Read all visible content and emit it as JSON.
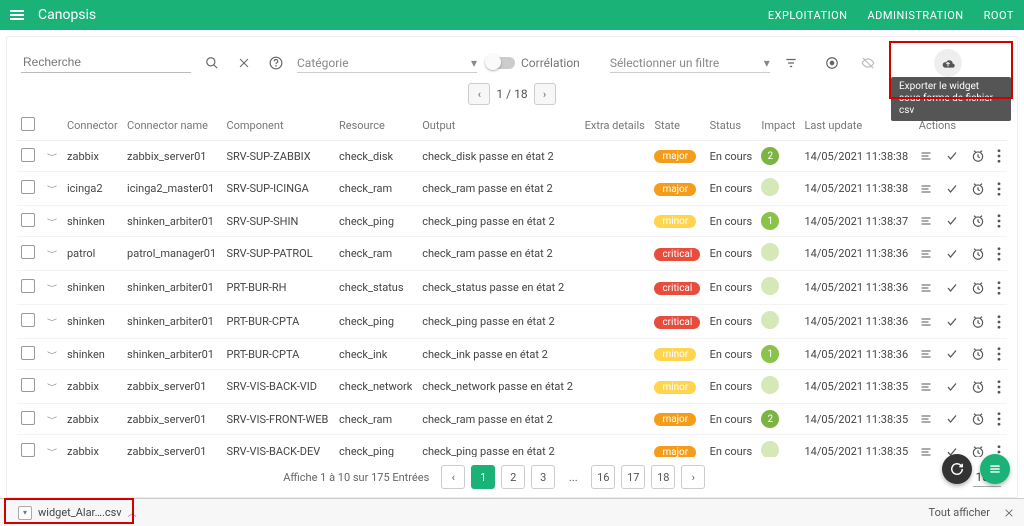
{
  "topbar": {
    "brand": "Canopsis",
    "links": {
      "exploitation": "EXPLOITATION",
      "administration": "ADMINISTRATION",
      "root": "ROOT"
    }
  },
  "filters": {
    "search_placeholder": "Recherche",
    "category_label": "Catégorie",
    "correlation_label": "Corrélation",
    "select_filter_label": "Sélectionner un filtre",
    "tooltip": "Exporter le widget sous forme de fichier csv",
    "top_pager": "1 / 18"
  },
  "columns": {
    "connector": "Connector",
    "connector_name": "Connector name",
    "component": "Component",
    "resource": "Resource",
    "output": "Output",
    "extra": "Extra details",
    "state": "State",
    "status": "Status",
    "impact": "Impact",
    "last_update": "Last update",
    "actions": "Actions"
  },
  "status_text": "En cours",
  "rows": [
    {
      "connector": "zabbix",
      "connector_name": "zabbix_server01",
      "component": "SRV-SUP-ZABBIX",
      "resource": "check_disk",
      "output": "check_disk passe en état 2",
      "state": "major",
      "impact": "2",
      "impcls": "imp2",
      "last_update": "14/05/2021 11:38:38"
    },
    {
      "connector": "icinga2",
      "connector_name": "icinga2_master01",
      "component": "SRV-SUP-ICINGA",
      "resource": "check_ram",
      "output": "check_ram passe en état 2",
      "state": "major",
      "impact": "",
      "impcls": "imp0",
      "last_update": "14/05/2021 11:38:38"
    },
    {
      "connector": "shinken",
      "connector_name": "shinken_arbiter01",
      "component": "SRV-SUP-SHIN",
      "resource": "check_ping",
      "output": "check_ping passe en état 2",
      "state": "minor",
      "impact": "1",
      "impcls": "imp1",
      "last_update": "14/05/2021 11:38:37"
    },
    {
      "connector": "patrol",
      "connector_name": "patrol_manager01",
      "component": "SRV-SUP-PATROL",
      "resource": "check_ram",
      "output": "check_ram passe en état 2",
      "state": "critical",
      "impact": "",
      "impcls": "imp0",
      "last_update": "14/05/2021 11:38:36"
    },
    {
      "connector": "shinken",
      "connector_name": "shinken_arbiter01",
      "component": "PRT-BUR-RH",
      "resource": "check_status",
      "output": "check_status passe en état 2",
      "state": "critical",
      "impact": "",
      "impcls": "imp0",
      "last_update": "14/05/2021 11:38:36"
    },
    {
      "connector": "shinken",
      "connector_name": "shinken_arbiter01",
      "component": "PRT-BUR-CPTA",
      "resource": "check_ping",
      "output": "check_ping passe en état 2",
      "state": "critical",
      "impact": "",
      "impcls": "imp0",
      "last_update": "14/05/2021 11:38:36"
    },
    {
      "connector": "shinken",
      "connector_name": "shinken_arbiter01",
      "component": "PRT-BUR-CPTA",
      "resource": "check_ink",
      "output": "check_ink passe en état 2",
      "state": "minor",
      "impact": "1",
      "impcls": "imp1",
      "last_update": "14/05/2021 11:38:36"
    },
    {
      "connector": "zabbix",
      "connector_name": "zabbix_server01",
      "component": "SRV-VIS-BACK-VID",
      "resource": "check_network",
      "output": "check_network passe en état 2",
      "state": "minor",
      "impact": "",
      "impcls": "imp0",
      "last_update": "14/05/2021 11:38:35"
    },
    {
      "connector": "zabbix",
      "connector_name": "zabbix_server01",
      "component": "SRV-VIS-FRONT-WEB",
      "resource": "check_ram",
      "output": "check_ram passe en état 2",
      "state": "major",
      "impact": "2",
      "impcls": "imp2",
      "last_update": "14/05/2021 11:38:35"
    },
    {
      "connector": "zabbix",
      "connector_name": "zabbix_server01",
      "component": "SRV-VIS-BACK-DEV",
      "resource": "check_ping",
      "output": "check_ping passe en état 2",
      "state": "major",
      "impact": "",
      "impcls": "imp0",
      "last_update": "14/05/2021 11:38:35"
    }
  ],
  "pager": {
    "summary": "Affiche 1 à 10 sur 175 Entrées",
    "pages_start": [
      "1",
      "2",
      "3"
    ],
    "ellipsis": "...",
    "pages_end": [
      "16",
      "17",
      "18"
    ],
    "page_size": "10"
  },
  "download": {
    "filename": "widget_Alar….csv",
    "show_all": "Tout afficher"
  }
}
